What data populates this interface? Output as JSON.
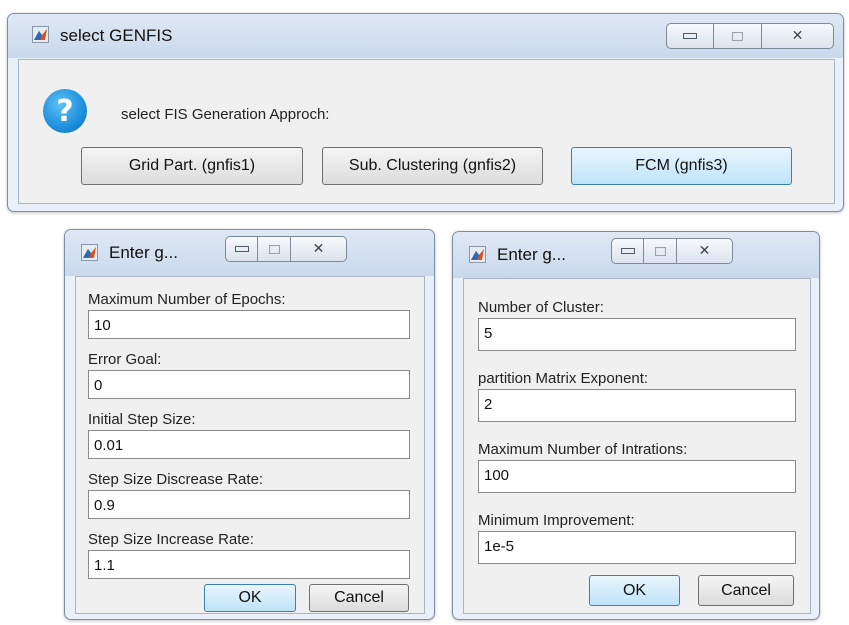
{
  "main_dialog": {
    "title": "select GENFIS",
    "icon": "matlab-icon",
    "help_icon": "question-icon",
    "help_glyph": "?",
    "close_glyph": "✕",
    "prompt": "select FIS Generation Approch:",
    "buttons": {
      "grid": "Grid Part. (gnfis1)",
      "sub": "Sub. Clustering (gnfis2)",
      "fcm": "FCM (gnfis3)"
    }
  },
  "left_dialog": {
    "title": "Enter g...",
    "close_glyph": "✕",
    "fields": [
      {
        "label": "Maximum Number of Epochs:",
        "value": "10"
      },
      {
        "label": "Error Goal:",
        "value": "0"
      },
      {
        "label": "Initial Step Size:",
        "value": "0.01"
      },
      {
        "label": "Step Size Discrease Rate:",
        "value": "0.9"
      },
      {
        "label": "Step Size Increase Rate:",
        "value": "1.1"
      }
    ],
    "ok_label": "OK",
    "cancel_label": "Cancel"
  },
  "right_dialog": {
    "title": "Enter g...",
    "close_glyph": "✕",
    "fields": [
      {
        "label": "Number of Cluster:",
        "value": "5"
      },
      {
        "label": "partition Matrix Exponent:",
        "value": "2"
      },
      {
        "label": "Maximum Number of Intrations:",
        "value": "100"
      },
      {
        "label": "Minimum Improvement:",
        "value": "1e-5"
      }
    ],
    "ok_label": "OK",
    "cancel_label": "Cancel"
  }
}
